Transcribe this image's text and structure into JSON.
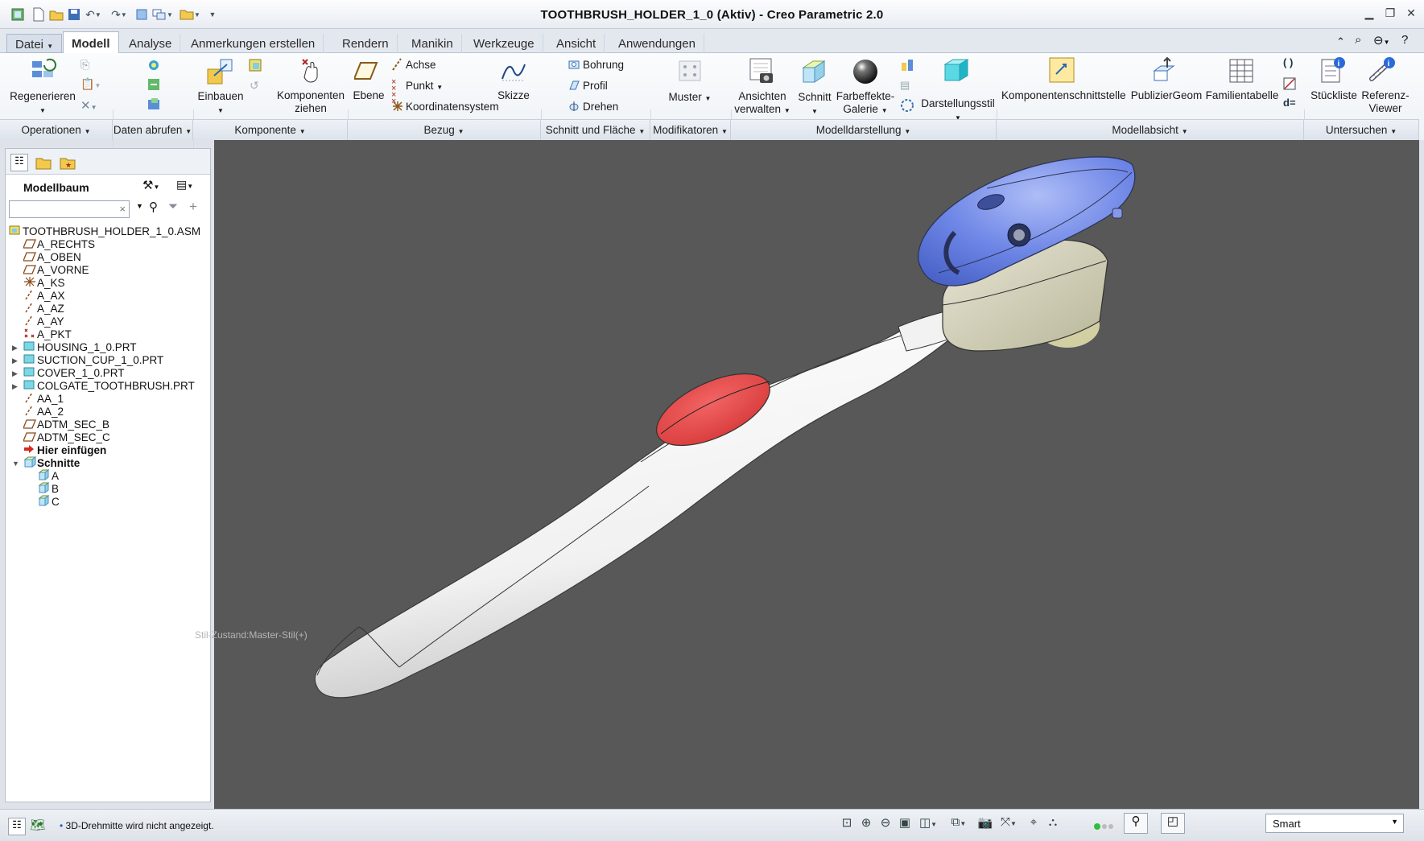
{
  "window": {
    "title": "TOOTHBRUSH_HOLDER_1_0 (Aktiv) - Creo Parametric 2.0"
  },
  "tabs": [
    "Datei",
    "Modell",
    "Analyse",
    "Anmerkungen erstellen",
    "Rendern",
    "Manikin",
    "Werkzeuge",
    "Ansicht",
    "Anwendungen"
  ],
  "ribbon": {
    "regenerieren": "Regenerieren",
    "einbauen": "Einbauen",
    "komponenten_ziehen_1": "Komponenten",
    "komponenten_ziehen_2": "ziehen",
    "ebene": "Ebene",
    "achse": "Achse",
    "punkt": "Punkt",
    "koordinatensystem": "Koordinatensystem",
    "skizze": "Skizze",
    "bohrung": "Bohrung",
    "profil": "Profil",
    "drehen": "Drehen",
    "muster": "Muster",
    "ansichten_1": "Ansichten",
    "ansichten_2": "verwalten",
    "schnitt": "Schnitt",
    "farbeffekte_1": "Farbeffekte-",
    "farbeffekte_2": "Galerie",
    "darstellungsstil": "Darstellungsstil",
    "komponentenschnittstelle": "Komponentenschnittstelle",
    "publiziergeom": "PublizierGeom",
    "familientabelle": "Familientabelle",
    "stueckliste": "Stückliste",
    "referenz_1": "Referenz-",
    "referenz_2": "Viewer"
  },
  "groups": [
    "Operationen",
    "Daten abrufen",
    "Komponente",
    "Bezug",
    "Schnitt und Fläche",
    "Modifikatoren",
    "Modelldarstellung",
    "Modellabsicht",
    "Untersuchen"
  ],
  "panel": {
    "title": "Modellbaum",
    "search_value": ""
  },
  "tree": [
    {
      "label": "TOOTHBRUSH_HOLDER_1_0.ASM",
      "icon": "assembly-icon",
      "level": 0,
      "expander": ""
    },
    {
      "label": "A_RECHTS",
      "icon": "datum-plane-icon",
      "level": 1,
      "expander": ""
    },
    {
      "label": "A_OBEN",
      "icon": "datum-plane-icon",
      "level": 1,
      "expander": ""
    },
    {
      "label": "A_VORNE",
      "icon": "datum-plane-icon",
      "level": 1,
      "expander": ""
    },
    {
      "label": "A_KS",
      "icon": "coordinate-system-icon",
      "level": 1,
      "expander": ""
    },
    {
      "label": "A_AX",
      "icon": "datum-axis-icon",
      "level": 1,
      "expander": ""
    },
    {
      "label": "A_AZ",
      "icon": "datum-axis-icon",
      "level": 1,
      "expander": ""
    },
    {
      "label": "A_AY",
      "icon": "datum-axis-icon",
      "level": 1,
      "expander": ""
    },
    {
      "label": "A_PKT",
      "icon": "datum-point-icon",
      "level": 1,
      "expander": ""
    },
    {
      "label": "HOUSING_1_0.PRT",
      "icon": "part-icon",
      "level": 1,
      "expander": "▶"
    },
    {
      "label": "SUCTION_CUP_1_0.PRT",
      "icon": "part-icon",
      "level": 1,
      "expander": "▶"
    },
    {
      "label": "COVER_1_0.PRT",
      "icon": "part-icon",
      "level": 1,
      "expander": "▶"
    },
    {
      "label": "COLGATE_TOOTHBRUSH.PRT",
      "icon": "part-icon",
      "level": 1,
      "expander": "▶"
    },
    {
      "label": "AA_1",
      "icon": "datum-axis-icon",
      "level": 1,
      "expander": ""
    },
    {
      "label": "AA_2",
      "icon": "datum-axis-icon",
      "level": 1,
      "expander": ""
    },
    {
      "label": "ADTM_SEC_B",
      "icon": "datum-plane-icon",
      "level": 1,
      "expander": ""
    },
    {
      "label": "ADTM_SEC_C",
      "icon": "datum-plane-icon",
      "level": 1,
      "expander": ""
    },
    {
      "label": "Hier einfügen",
      "icon": "insert-arrow-icon",
      "level": 1,
      "expander": ""
    },
    {
      "label": "Schnitte",
      "icon": "sections-folder-icon",
      "level": 1,
      "expander": "▼"
    },
    {
      "label": "A",
      "icon": "section-icon",
      "level": 2,
      "expander": ""
    },
    {
      "label": "B",
      "icon": "section-icon",
      "level": 2,
      "expander": ""
    },
    {
      "label": "C",
      "icon": "section-icon",
      "level": 2,
      "expander": ""
    }
  ],
  "viewport": {
    "style_state": "Stil-Zustand:Master-Stil(+)"
  },
  "status": {
    "message": "3D-Drehmitte wird nicht angezeigt.",
    "filter_value": "Smart"
  },
  "colors": {
    "viewport_bg": "#585858",
    "cover_blue": "#6e86e6",
    "brush_red": "#e44a4a"
  }
}
